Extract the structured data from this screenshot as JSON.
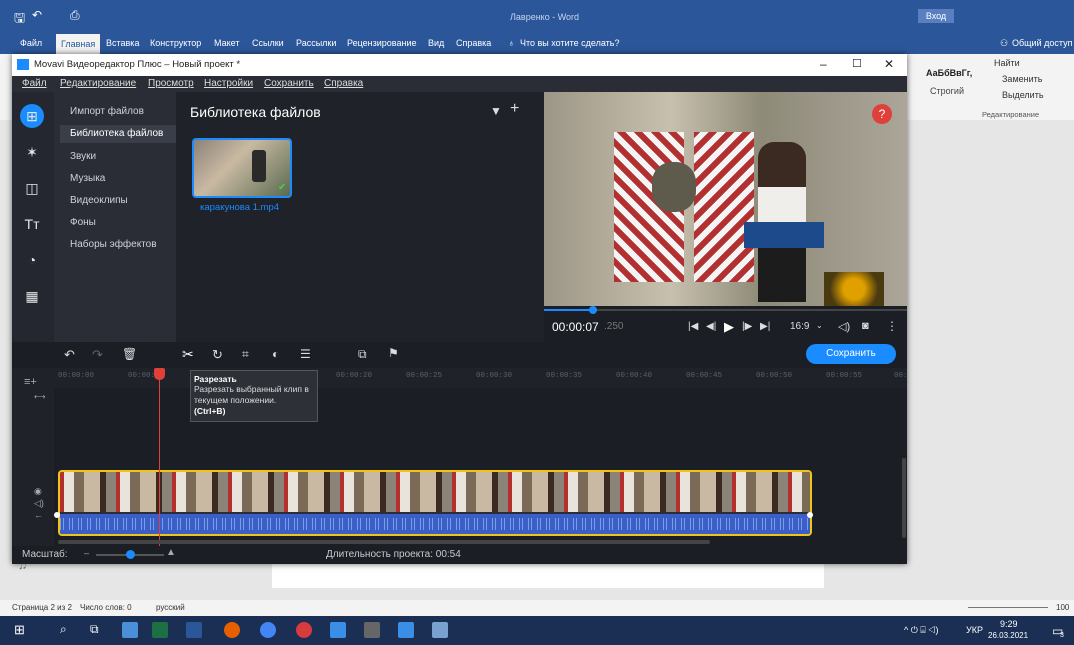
{
  "word": {
    "title": "Лавренко - Word",
    "signin": "Вход",
    "tabs": [
      "Файл",
      "Главная",
      "Вставка",
      "Конструктор",
      "Макет",
      "Ссылки",
      "Рассылки",
      "Рецензирование",
      "Вид",
      "Справка"
    ],
    "tell_me": "Что вы хотите сделать?",
    "share": "Общий доступ",
    "style_preview": "АаБбВвГг,",
    "style_name": "Строгий",
    "find": "Найти",
    "replace": "Заменить",
    "select": "Выделить",
    "group_editing": "Редактирование",
    "status": {
      "page": "Страница 2 из 2",
      "words": "Число слов: 0",
      "lang": "русский",
      "zoom": "100"
    }
  },
  "taskbar": {
    "lang": "УКР",
    "time": "9:29",
    "date": "26.03.2021",
    "notifications": "3"
  },
  "movavi": {
    "title": "Movavi Видеоредактор Плюс – Новый проект *",
    "menu": [
      "Файл",
      "Редактирование",
      "Просмотр",
      "Настройки",
      "Сохранить",
      "Справка"
    ],
    "categories": [
      "Импорт файлов",
      "Библиотека файлов",
      "Звуки",
      "Музыка",
      "Видеоклипы",
      "Фоны",
      "Наборы эффектов"
    ],
    "library_title": "Библиотека файлов",
    "clip_name": "каракунова 1.mp4",
    "help": "?",
    "timecode_main": "00:00:07",
    "timecode_ms": ".250",
    "aspect": "16:9",
    "save_button": "Сохранить",
    "ruler": [
      "00:00:00",
      "00:00:05",
      "00:00:20",
      "00:00:25",
      "00:00:30",
      "00:00:35",
      "00:00:40",
      "00:00:45",
      "00:00:50",
      "00:00:55",
      "00:"
    ],
    "tooltip": {
      "title": "Разрезать",
      "body": "Разрезать выбранный клип в текущем положении.",
      "shortcut": "(Ctrl+B)"
    },
    "zoom_label": "Масштаб:",
    "duration": "Длительность проекта: 00:54",
    "playhead_progress": 0.135
  },
  "colors": {
    "accent": "#1a8cff",
    "clip_border": "#f0c419",
    "playhead": "#e0403a"
  }
}
